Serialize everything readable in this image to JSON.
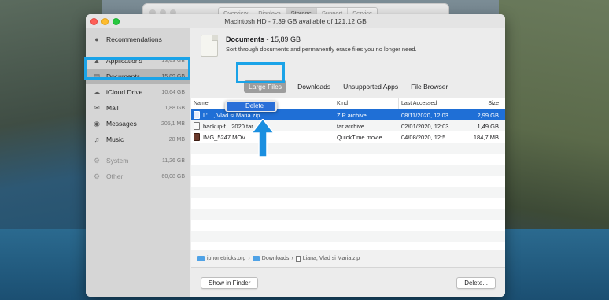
{
  "back_window": {
    "tabs": [
      "Overview",
      "Displays",
      "Storage",
      "Support",
      "Service"
    ],
    "active_tab": "Storage"
  },
  "window": {
    "title": "Macintosh HD - 7,39 GB available of 121,12 GB"
  },
  "sidebar": {
    "items": [
      {
        "label": "Recommendations",
        "size": "",
        "icon": "lightbulb-icon"
      },
      {
        "label": "Applications",
        "size": "13,63 GB",
        "icon": "applications-icon"
      },
      {
        "label": "Documents",
        "size": "15,89 GB",
        "icon": "documents-icon"
      },
      {
        "label": "iCloud Drive",
        "size": "10,64 GB",
        "icon": "cloud-icon"
      },
      {
        "label": "Mail",
        "size": "1,88 GB",
        "icon": "mail-icon"
      },
      {
        "label": "Messages",
        "size": "205,1 MB",
        "icon": "messages-icon"
      },
      {
        "label": "Music",
        "size": "20 MB",
        "icon": "music-icon"
      },
      {
        "label": "System",
        "size": "11,26 GB",
        "icon": "system-icon"
      },
      {
        "label": "Other",
        "size": "60,08 GB",
        "icon": "other-icon"
      }
    ],
    "selected": "Documents"
  },
  "header": {
    "title": "Documents",
    "size": " - 15,89 GB",
    "description": "Sort through documents and permanently erase files you no longer need."
  },
  "tabs": [
    "Large Files",
    "Downloads",
    "Unsupported Apps",
    "File Browser"
  ],
  "active_tab": "Large Files",
  "table": {
    "columns": [
      "Name",
      "Kind",
      "Last Accessed",
      "Size"
    ],
    "rows": [
      {
        "name": "L'…, Vlad si Maria.zip",
        "kind": "ZIP archive",
        "date": "08/11/2020, 12:03…",
        "size": "2,99 GB",
        "selected": true
      },
      {
        "name": "backup-f…2020.tar",
        "kind": "tar archive",
        "date": "02/01/2020, 12:03…",
        "size": "1,49 GB",
        "selected": false
      },
      {
        "name": "IMG_5247.MOV",
        "kind": "QuickTime movie",
        "date": "04/08/2020, 12:5…",
        "size": "184,7 MB",
        "selected": false
      }
    ]
  },
  "context_menu": {
    "item": "Delete"
  },
  "pathbar": {
    "segments": [
      "iphonetricks.org",
      "Downloads",
      "Liana, Vlad si Maria.zip"
    ]
  },
  "footer": {
    "show_in_finder": "Show in Finder",
    "delete": "Delete..."
  },
  "colors": {
    "selection": "#1f6fd6",
    "highlight_box": "#1aa3e8",
    "arrow": "#1a8fe0"
  }
}
